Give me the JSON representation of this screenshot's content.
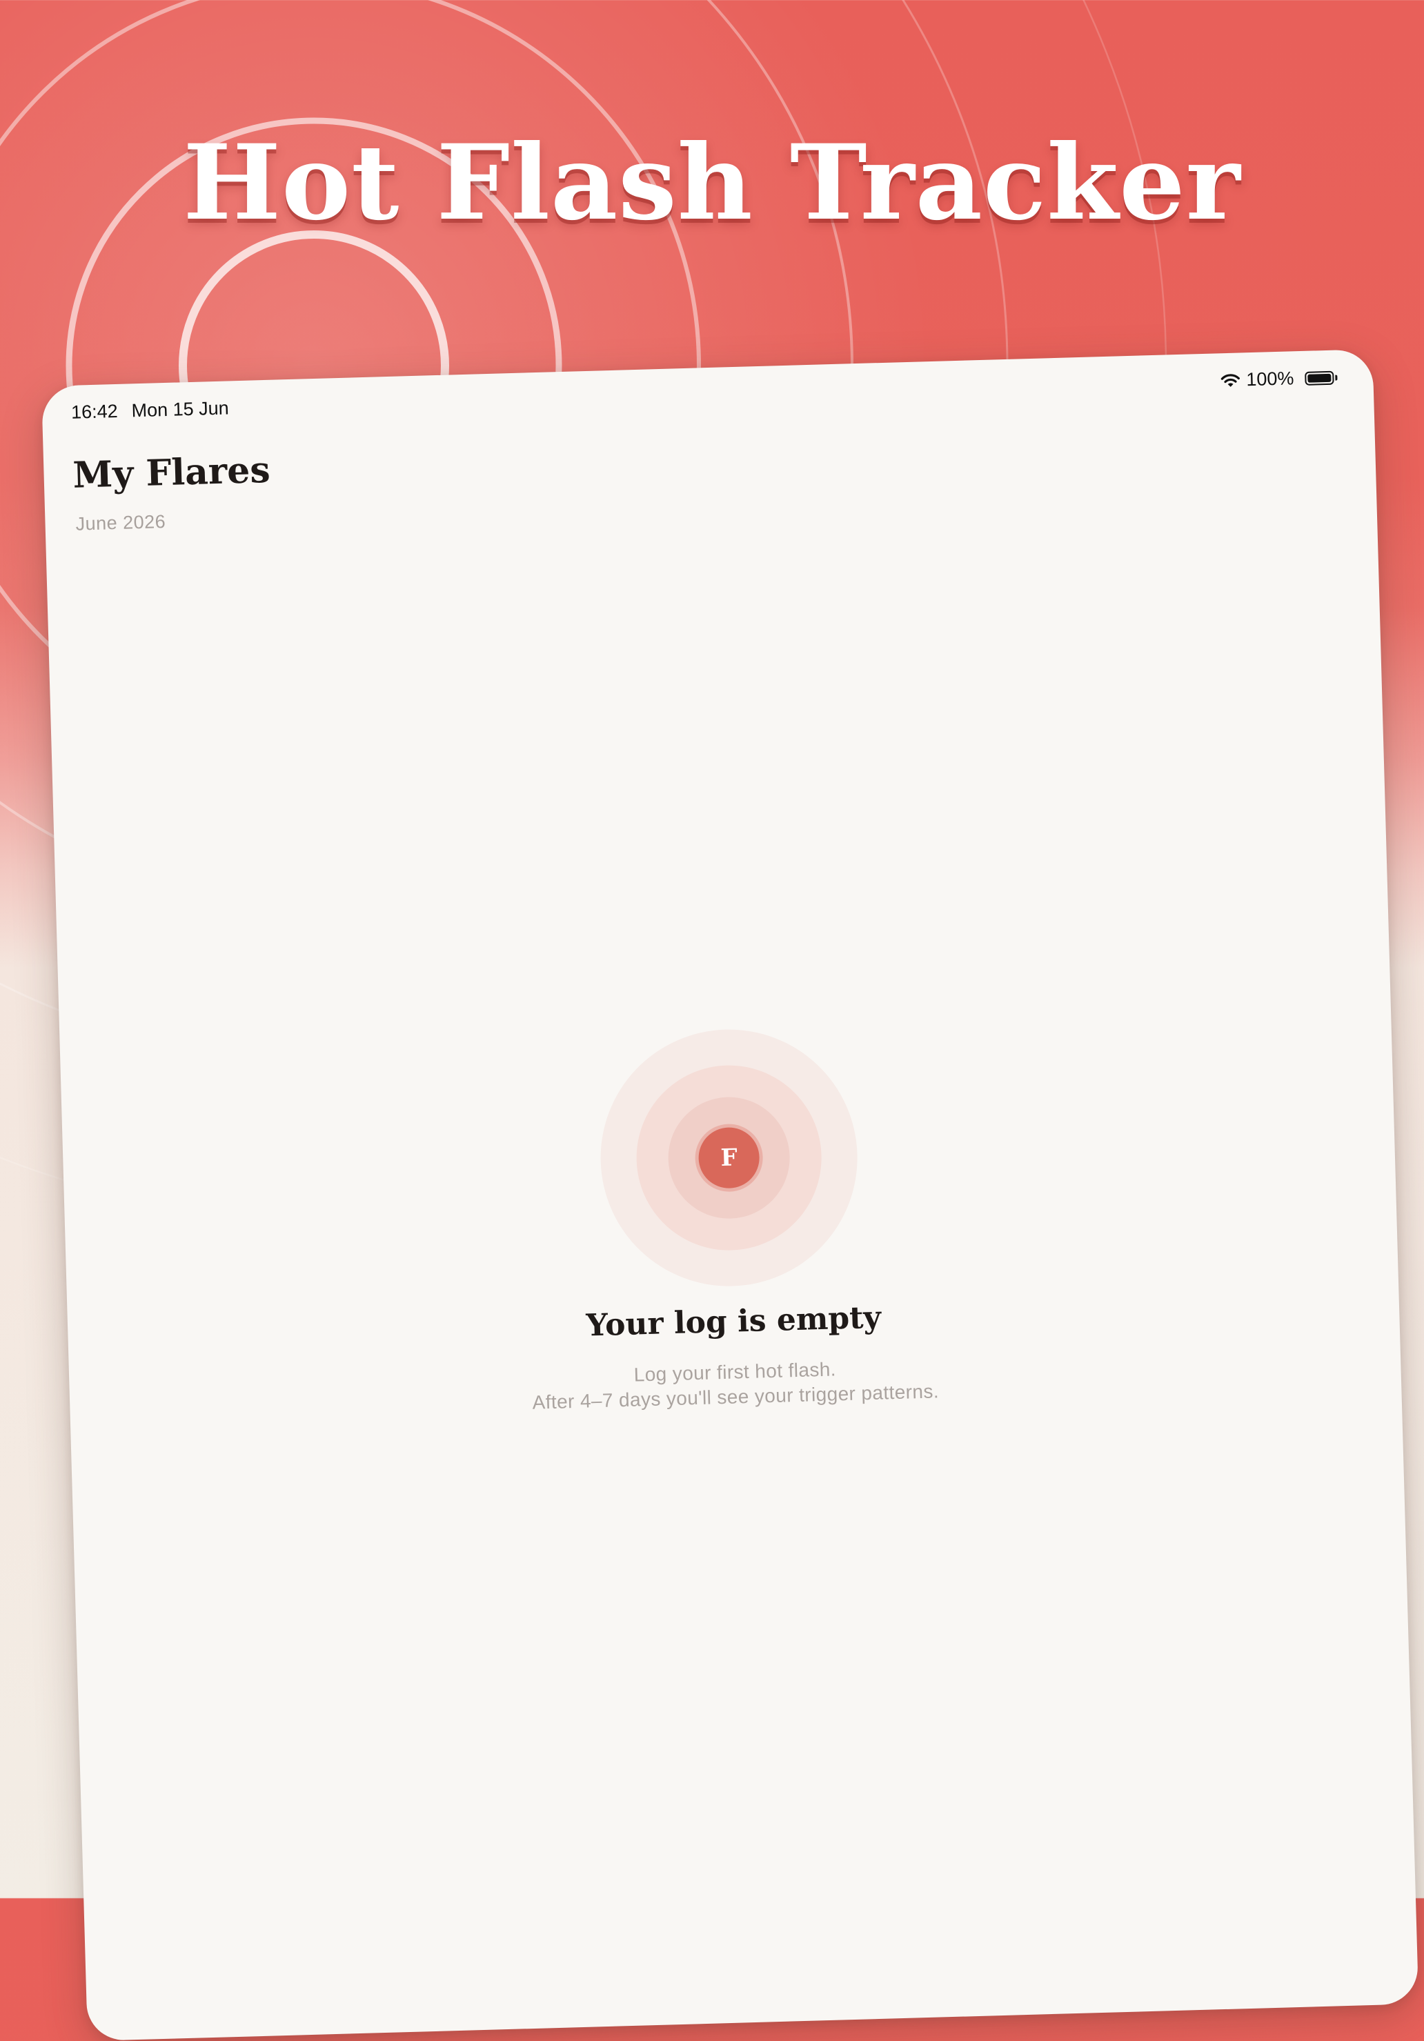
{
  "headline": "Hot Flash Tracker",
  "status_bar": {
    "time": "16:42",
    "date": "Mon 15 Jun",
    "battery_percent": "100%",
    "battery_level": 1.0,
    "wifi_icon": "wifi-icon",
    "battery_icon": "battery-icon"
  },
  "page": {
    "title": "My Flares",
    "subtitle": "June 2026"
  },
  "empty_state": {
    "badge_letter": "F",
    "title": "Your log is empty",
    "line1": "Log your first hot flash.",
    "line2": "After 4–7 days you'll see your trigger patterns."
  },
  "colors": {
    "brand_red": "#e8605a",
    "accent_coral": "#d9685a",
    "screen_bg": "#f9f7f4",
    "title_text": "#1f1a18",
    "muted_text": "#a7a09c"
  }
}
